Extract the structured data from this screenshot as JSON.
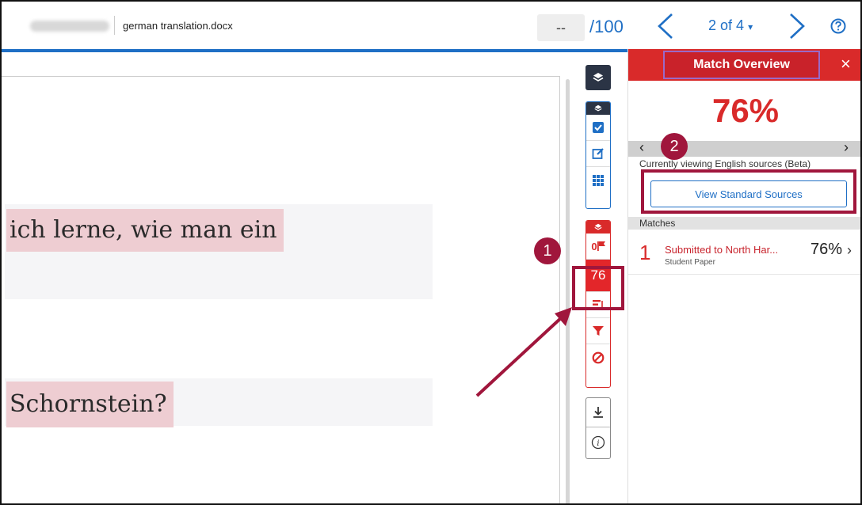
{
  "header": {
    "filename": "german translation.docx",
    "score_value": "--",
    "score_denominator": "/100",
    "page_indicator": "2 of 4",
    "help_icon": "help-icon"
  },
  "document": {
    "line1": "ich lerne, wie man ein",
    "line2": "Schornstein?"
  },
  "toolbar": {
    "similarity_score": "76",
    "flag_count": "0"
  },
  "panel": {
    "title": "Match Overview",
    "close_label": "×",
    "percentage": "76%",
    "viewing_note": "Currently viewing English sources (Beta)",
    "view_standard_label": "View Standard Sources",
    "matches_header": "Matches",
    "matches": [
      {
        "rank": "1",
        "title": "Submitted to North Har...",
        "type": "Student Paper",
        "percent": "76%"
      }
    ]
  },
  "annotations": {
    "badge1": "1",
    "badge2": "2"
  },
  "colors": {
    "accent_red": "#d92a2a",
    "accent_blue": "#1f6fc5",
    "annotation": "#a0163c",
    "highlight": "#eecdd2"
  }
}
